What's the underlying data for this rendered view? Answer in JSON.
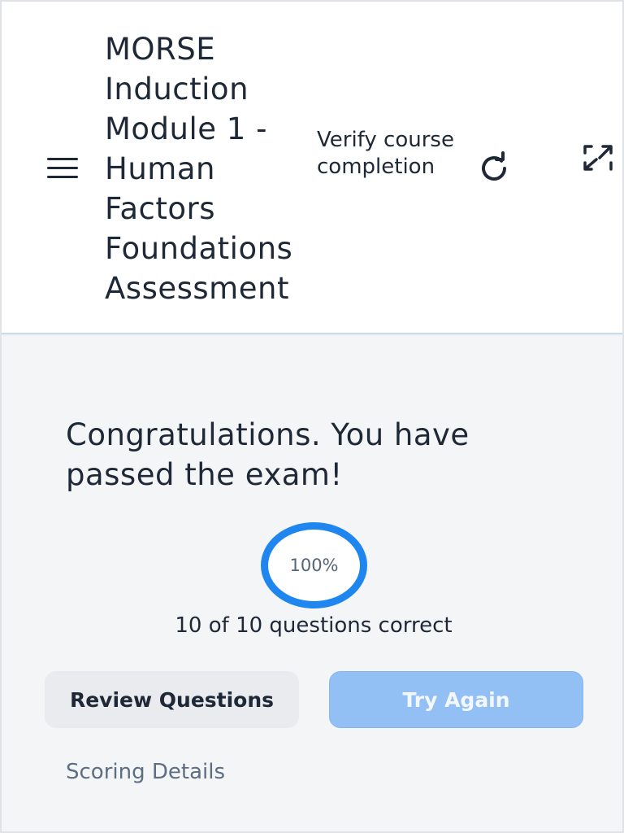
{
  "header": {
    "course_title": "MORSE Induction Module 1 - Human Factors Foundations Assessment",
    "verify_label": "Verify course completion",
    "icons": {
      "menu": "hamburger-menu-icon",
      "refresh": "refresh-icon",
      "fullscreen": "fullscreen-icon"
    }
  },
  "result": {
    "heading": "Congratulations. You have passed the exam!",
    "score_percent_label": "100%",
    "score_fraction": 1.0,
    "questions_correct": "10 of 10 questions correct"
  },
  "actions": {
    "review_label": "Review Questions",
    "try_again_label": "Try Again"
  },
  "links": {
    "scoring_details": "Scoring Details"
  },
  "colors": {
    "accent": "#1f86f0",
    "try_again_bg": "#93c0f4",
    "review_bg": "#e9ebee",
    "page_bg": "#f3f5f7",
    "text": "#1e2836",
    "muted_text": "#5d6e83"
  }
}
